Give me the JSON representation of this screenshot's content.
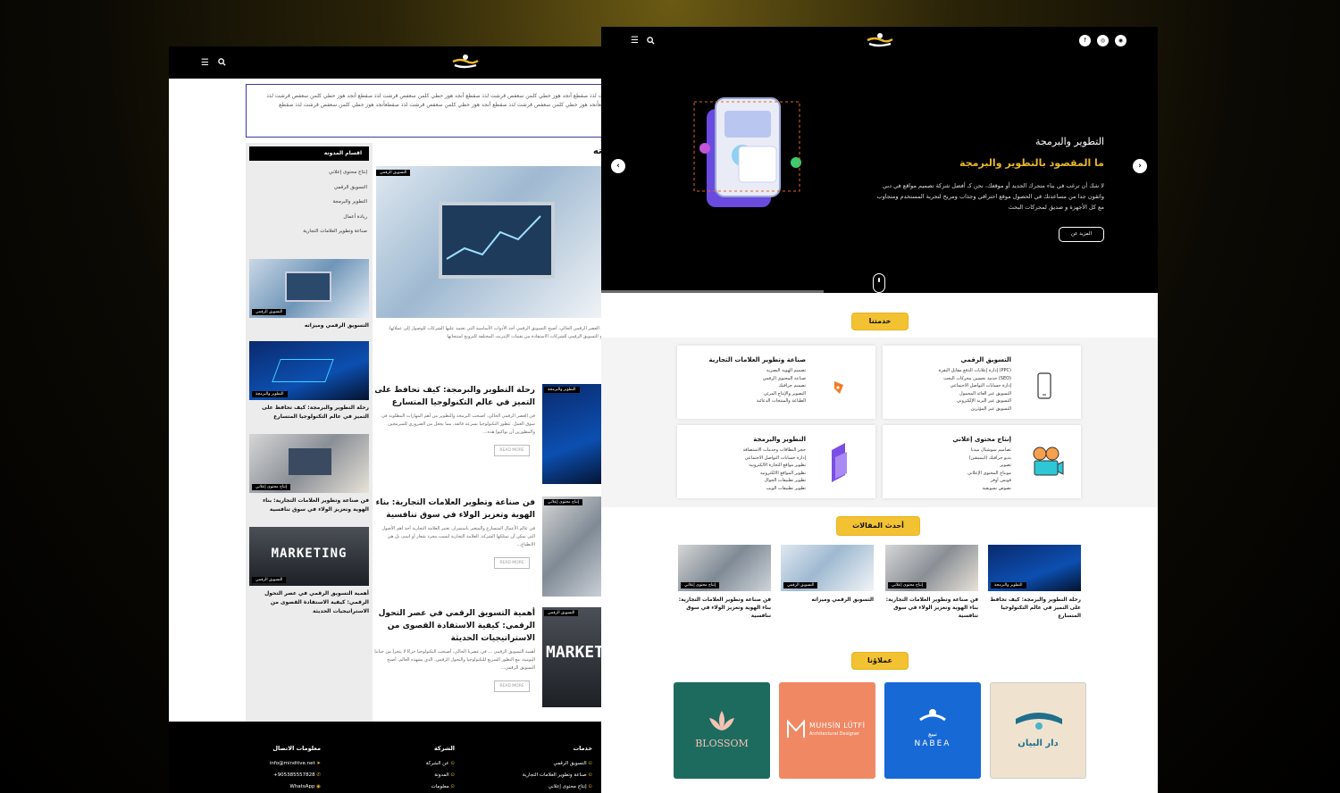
{
  "left": {
    "banner_text": "بريخت لذذ صقطع أنجد هوز حطي كلمن سعفص قرشت لذذ صقطع أنجد هوز حطي كلمن سعفص قرشت لذذ صقطع أنجد هوز حطي كلمن سعفص قرشت لذذ صقطعأنجد هوز حطي كلمن سعفص قرشت لذذ صقطع أنجد هوز حطي كلمن سعفص قرشت لذذ صقطعأنجد هوز حطي كلمن سعفص قرشت لذذ صقطع",
    "sidebar": {
      "heading": "اقسام المدونة",
      "categories": [
        "إنتاج محتوى إعلاني",
        "التسويق الرقمي",
        "التطوير والبرمجة",
        "ريادة أعمال",
        "صناعة وتطوير العلامات التجارية"
      ],
      "posts": [
        {
          "tag": "التسويق الرقمي",
          "title": "التسويق الرقمي وميزاته"
        },
        {
          "tag": "التطوير والبرمجة",
          "title": "رحلة التطوير والبرمجة: كيف تحافظ على التميز في عالم التكنولوجيا المتسارع"
        },
        {
          "tag": "إنتاج محتوى إعلاني",
          "title": "فن صناعة وتطوير العلامات التجارية: بناء الهوية وتعزيز الولاء في سوق تنافسية"
        },
        {
          "tag": "التسويق الرقمي",
          "title": "أهمية التسويق الرقمي في عصر التحول الرقمي: كيفية الاستفادة القصوى من الاستراتيجيات الحديثة"
        }
      ]
    },
    "featured": {
      "title": "زاته",
      "tag": "التسويق الرقمي",
      "excerpt": "في العصر الرقمي الحالي، أصبح التسويق الرقمي أحد الأدوات الأساسية التي تعتمد عليها الشركات للوصول إلى عملائها. يتيح التسويق الرقمي للشركات الاستفادة من تقنيات الإنترنت المختلفة للترويج لمنتجاتها"
    },
    "posts": [
      {
        "tag": "التطوير والبرمجة",
        "title": "رحلة التطوير والبرمجة: كيف تحافظ على التميز في عالم التكنولوجيا المتسارع",
        "excerpt": "في العصر الرقمي الحالي، أصبحت البرمجة والتطوير من أهم المهارات المطلوبة في سوق العمل. تتطور التكنولوجيا بسرعة فائقة، مما يجعل من الضروري للمبرمجين والمطورين أن يواكبوا هذه...",
        "read_more": "READ MORE"
      },
      {
        "tag": "إنتاج محتوى إعلاني",
        "title": "فن صناعة وتطوير العلامات التجارية: بناء الهوية وتعزيز الولاء في سوق تنافسية",
        "excerpt": "في عالم الأعمال المتسارع والمتغير باستمرار، تعتبر العلامة التجارية أحد أهم الأصول التي يمكن أن تمتلكها الشركة. العلامة التجارية ليست مجرد شعار أو اسم، بل هي الانطباع...",
        "read_more": "READ MORE"
      },
      {
        "tag": "التسويق الرقمي",
        "title": "أهمية التسويق الرقمي في عصر التحول الرقمي: كيفية الاستفادة القصوى من الاستراتيجيات الحديثة",
        "excerpt": "أهمية التسويق الرقمي ... في عصرنا الحالي، أصبحت التكنولوجيا جزءًا لا يتجزأ من حياتنا اليومية، مع التطور السريع للتكنولوجيا والتحول الرقمي، الذي يشهده العالم، أصبح التسويق الرقمي...",
        "read_more": "READ MORE"
      }
    ],
    "marketing_word": "MARKETING",
    "footer": {
      "contact": {
        "heading": "معلومات الاتصال",
        "items": [
          "info@mindtive.net",
          "905385557828+",
          "WhatsApp"
        ]
      },
      "company": {
        "heading": "الشركة",
        "items": [
          "عن الشركة",
          "المدونة",
          "معلومات"
        ]
      },
      "services": {
        "heading": "خدمات",
        "items": [
          "التسويق الرقمي",
          "صناعة وتطوير العلامات التجارية",
          "إنتاج محتوى إعلاني"
        ]
      }
    }
  },
  "right": {
    "socials": [
      "f",
      "◎",
      "◉"
    ],
    "hero": {
      "heading": "التطوير والبرمجة",
      "subheading": "ما المقصود بالتطوير والبرمجة",
      "text": "لا شك أن ترغب في بناء متجرك الجديد أو موقعك، نحن كـ أفضل شركة تصميم مواقع في دبي واثقون جدا من مساعدتك في الحصول موقع احترافي وجذاب ومريح لتجربة المستخدم ومتجاوب مع كل الأجهزة و صديق لمحركات البحث",
      "button": "المزيد عن"
    },
    "services_label": "خدمتنا",
    "services": [
      {
        "title": "التسويق الرقمي",
        "items": [
          "(PPC) إدارة إعلانات الدفع مقابل النقرة",
          "(SEO) خدمة تحسين محركات البحث",
          "إدارة حسابات التواصل الاجتماعي",
          "التسويق عبر العائد المحمول",
          "التسويق عبر البريد الإلكتروني",
          "التسويق عبر المؤثرين"
        ],
        "icon": "phone-icon"
      },
      {
        "title": "صناعة وتطوير العلامات التجارية",
        "items": [
          "تصميم الهوية البصرية",
          "صناعة المحتوى الرقمي",
          "تصميم جرافيك",
          "التصوير والإنتاج المرئي",
          "الطباعة والمنتجات الدعائية"
        ],
        "icon": "pen-icon"
      },
      {
        "title": "إنتاج محتوى إعلاني",
        "items": [
          "تصاميم سوشيال ميديا",
          "بديو جرافيك (انيميشن)",
          "تصوير",
          "مونتاج المحتوى الإعلاني",
          "فويس أوفر",
          "نصوص تسويقية"
        ],
        "icon": "camera-icon"
      },
      {
        "title": "التطوير والبرمجة",
        "items": [
          "حجز النطاقات وخدمات الاستضافة",
          "إدارة حسابات التواصل الاجتماعي",
          "تطوير مواقع التجارة الالكترونية",
          "تطوير المواقع الالكترونية",
          "تطوير تطبيقات الجوال",
          "تطوير تطبيقات الويب"
        ],
        "icon": "code-icon"
      }
    ],
    "articles_label": "أحدث المقالات",
    "articles": [
      {
        "tag": "التطوير والبرمجة",
        "title": "رحلة التطوير والبرمجة: كيف تحافظ على التميز في عالم التكنولوجيا المتسارع"
      },
      {
        "tag": "إنتاج محتوى إعلاني",
        "title": "فن صناعة وتطوير العلامات التجارية: بناء الهوية وتعزيز الولاء في سوق تنافسية"
      },
      {
        "tag": "التسويق الرقمي",
        "title": "التسويق الرقمي وميزاته"
      },
      {
        "tag": "إنتاج محتوى إعلاني",
        "title": "فن صناعة وتطوير العلامات التجارية: بناء الهوية وتعزيز الولاء في سوق تنافسية"
      }
    ],
    "clients_label": "عملاؤنا",
    "clients": [
      {
        "name": "دار البيان",
        "bg": "#efe3cf",
        "fg": "#1f6e8c"
      },
      {
        "name": "NABEA",
        "sub": "نبيع",
        "bg": "#1769d6",
        "fg": "#ffffff"
      },
      {
        "name": "MUHSİN LÜTFİ",
        "sub": "Architectural Designer",
        "bg": "#f08863",
        "fg": "#ffffff"
      },
      {
        "name": "BLOSSOM",
        "bg": "#1d6b5f",
        "fg": "#f3c3b4"
      }
    ],
    "colors": {
      "accent": "#f3c232",
      "dark": "#000000"
    }
  }
}
